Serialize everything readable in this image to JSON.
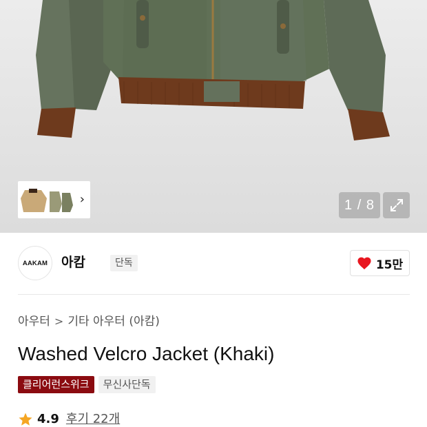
{
  "gallery": {
    "counter": "1 / 8",
    "thumb_arrow": "›"
  },
  "brand": {
    "logo_text": "AAKAM",
    "name": "아캄",
    "tag": "단독",
    "likes": "15만"
  },
  "breadcrumb": {
    "category": "아우터",
    "separator": ">",
    "subcategory": "기타 아우터 (아캄)"
  },
  "product": {
    "title": "Washed Velcro Jacket (Khaki)",
    "badges": [
      "클리어런스위크",
      "무신사단독"
    ]
  },
  "rating": {
    "score": "4.9",
    "reviews": "후기 22개"
  },
  "colors": {
    "jacket": "#5d6a55",
    "rib": "#6e3a1d",
    "sale_badge": "#8b0b10",
    "heart": "#e8161f",
    "star": "#f5a623"
  }
}
